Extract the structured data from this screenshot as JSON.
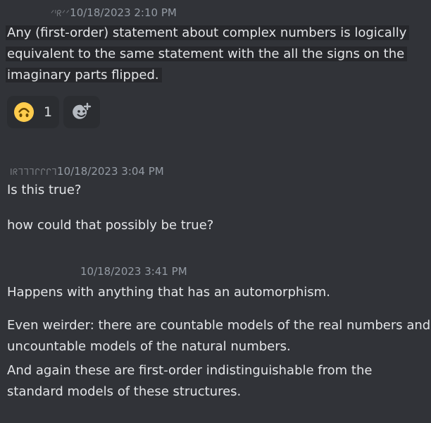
{
  "messages": [
    {
      "author": "ᐟᑊᖇᐟᐟ",
      "timestamp": "10/18/2023 2:10 PM",
      "lines": [
        "Any (first-order) statement about complex numbers is logically",
        "equivalent to the same statement with the all the signs on the",
        "imaginary parts flipped."
      ],
      "reactions": [
        {
          "emoji": "upside-down-face",
          "count": "1"
        }
      ],
      "add_reaction_icon": "add-emoji-icon"
    },
    {
      "author": "Iᖇᒣᒣᒣᒋᒋᒋᒣ",
      "timestamp": "10/18/2023 3:04 PM",
      "lines": [
        "Is this true?",
        "how could that possibly be true?"
      ]
    },
    {
      "author": "",
      "timestamp": "10/18/2023 3:41 PM",
      "lines": [
        "Happens with anything that has an automorphism.",
        "Even weirder: there are countable models of the real numbers and",
        "uncountable models of the natural numbers.",
        "And again these are first-order indistinguishable from the",
        "standard models of these structures."
      ]
    }
  ],
  "colors": {
    "background": "#313338",
    "text": "#e3e5e8",
    "timestamp": "#949ba4",
    "reaction_bg": "#2b2d31",
    "highlight_bg": "#26272b",
    "emoji_yellow": "#ffcc4d"
  }
}
